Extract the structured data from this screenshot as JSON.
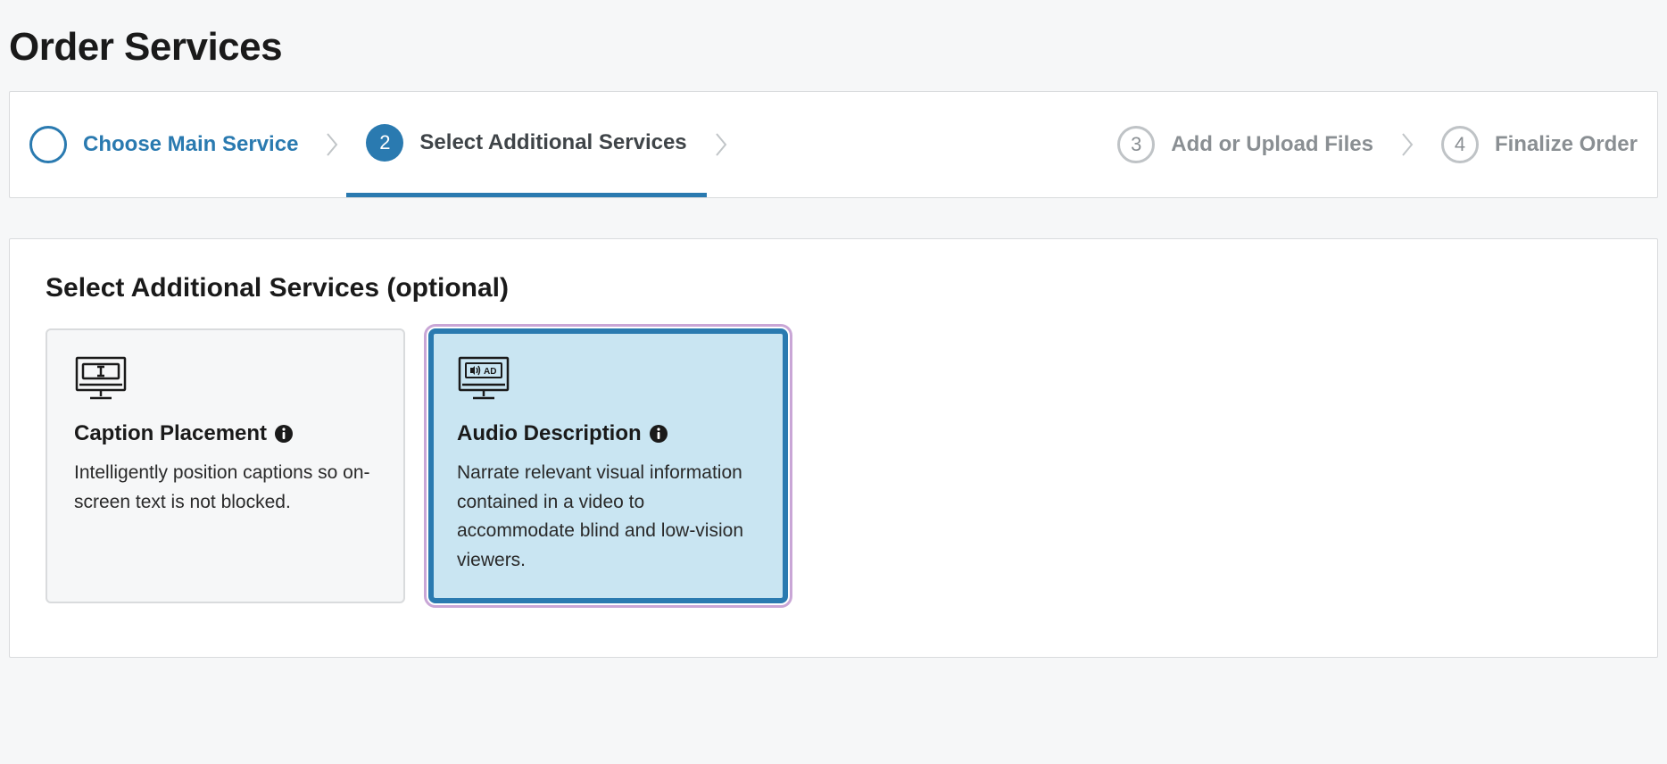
{
  "page": {
    "title": "Order Services"
  },
  "stepper": {
    "steps": [
      {
        "num": "",
        "label": "Choose Main Service",
        "state": "completed"
      },
      {
        "num": "2",
        "label": "Select Additional Services",
        "state": "current"
      },
      {
        "num": "3",
        "label": "Add or Upload Files",
        "state": "upcoming"
      },
      {
        "num": "4",
        "label": "Finalize Order",
        "state": "upcoming"
      }
    ]
  },
  "section": {
    "title": "Select Additional Services (optional)"
  },
  "cards": [
    {
      "title": "Caption Placement",
      "desc": "Intelligently position captions so on-screen text is not blocked.",
      "selected": false
    },
    {
      "title": "Audio Description",
      "desc": "Narrate relevant visual information contained in a video to accommodate blind and low-vision viewers.",
      "selected": true
    }
  ]
}
